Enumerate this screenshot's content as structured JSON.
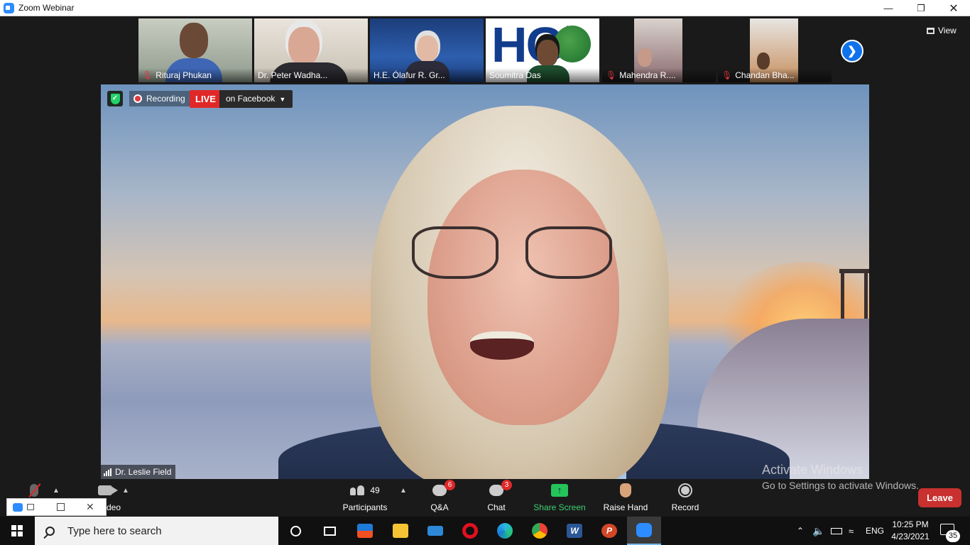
{
  "window": {
    "title": "Zoom Webinar"
  },
  "thumbnails": [
    {
      "name": "Rituraj Phukan",
      "muted": true
    },
    {
      "name": "Dr. Peter Wadha...",
      "muted": false
    },
    {
      "name": "H.E. Ólafur R. Gr...",
      "muted": false
    },
    {
      "name": "Soumitra Das",
      "muted": false
    },
    {
      "name": "Mahendra R....",
      "muted": true
    },
    {
      "name": "Chandan Bha...",
      "muted": true
    }
  ],
  "thumb4_logo": "HGi",
  "view_label": "View",
  "main_video": {
    "recording_label": "Recording",
    "live_label": "LIVE",
    "live_target": "on Facebook",
    "speaker_name": "Dr. Leslie Field"
  },
  "watermark": {
    "line1": "Activate Windows",
    "line2": "Go to Settings to activate Windows."
  },
  "controls": {
    "video_label": "deo",
    "participants_label": "Participants",
    "participants_count": "49",
    "qa_label": "Q&A",
    "qa_badge": "6",
    "chat_label": "Chat",
    "chat_badge": "3",
    "share_label": "Share Screen",
    "raise_label": "Raise Hand",
    "record_label": "Record",
    "leave_label": "Leave"
  },
  "taskbar": {
    "search_placeholder": "Type here to search",
    "word_letter": "W",
    "ppt_letter": "P",
    "language": "ENG",
    "time": "10:25 PM",
    "date": "4/23/2021",
    "notification_count": "35"
  },
  "colors": {
    "accent_blue": "#0e72ed",
    "live_red": "#e02828",
    "share_green": "#24c45a",
    "leave_red": "#c8312f"
  }
}
